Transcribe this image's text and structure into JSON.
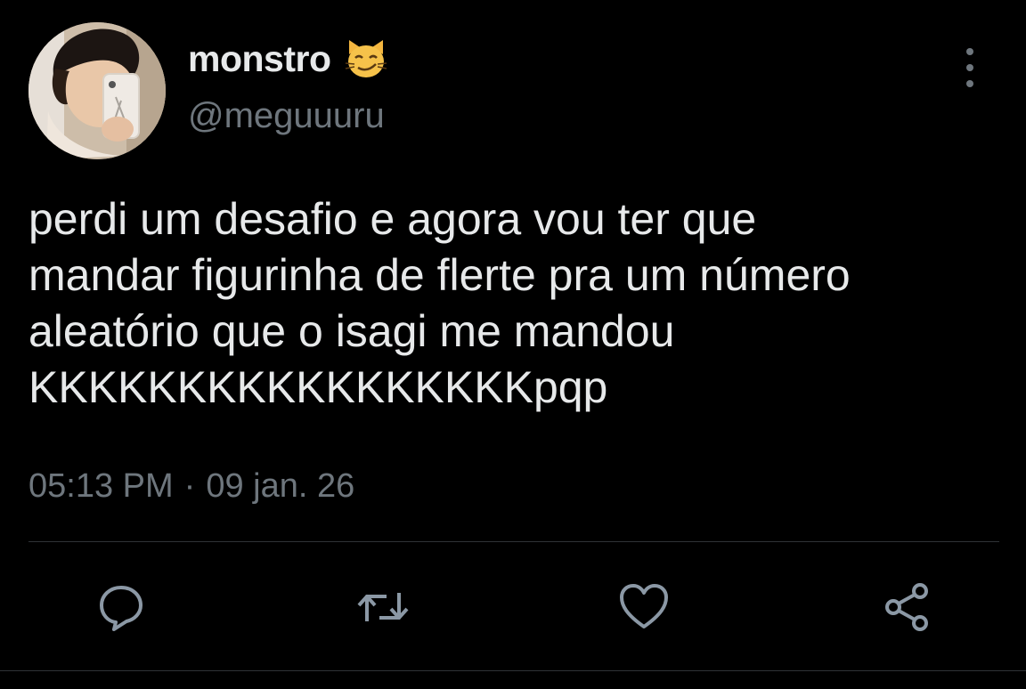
{
  "user": {
    "display_name": "monstro",
    "name_emoji": "smirking-cat-emoji",
    "handle": "@meguuuru",
    "avatar": "profile-photo"
  },
  "tweet": {
    "text": "perdi um desafio e agora vou ter que\nmandar figurinha de flerte pra um número\naleatório que o isagi me mandou\nKKKKKKKKKKKKKKKKKpqp",
    "time": "05:13 PM",
    "separator": "·",
    "date": "09 jan. 26"
  },
  "actions": {
    "reply_icon": "reply-icon",
    "retweet_icon": "retweet-icon",
    "like_icon": "heart-icon",
    "share_icon": "share-icon",
    "more_icon": "more-vertical-icon"
  },
  "colors": {
    "background": "#000000",
    "text_primary": "#e7e9ea",
    "text_secondary": "#6e767d",
    "divider": "#2f3336",
    "icon": "#8b98a5"
  }
}
